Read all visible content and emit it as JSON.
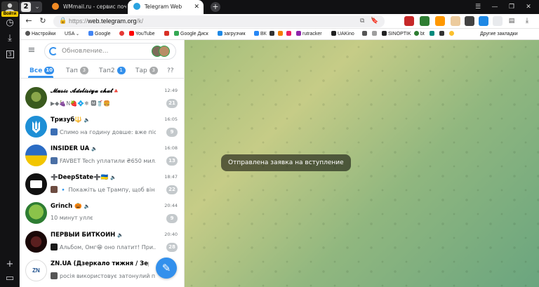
{
  "rail": {
    "user_badge": "Войти"
  },
  "tabs": {
    "counter": "2",
    "items": [
      {
        "title": "WMmail.ru - сервис почт",
        "active": false,
        "icon_color": "#f08a24"
      },
      {
        "title": "Telegram Web",
        "active": true,
        "icon_color": "#2aa3e0"
      }
    ]
  },
  "address": {
    "scheme": "https://",
    "domain": "web.telegram.org",
    "path": "/k/"
  },
  "bookmarks": [
    {
      "label": "Настройки",
      "color": "#555555"
    },
    {
      "label": "USA",
      "color": "#ffffff"
    },
    {
      "label": "Google",
      "color": "#4285f4"
    },
    {
      "label": "",
      "color": "#e53935"
    },
    {
      "label": "YouTube",
      "color": "#ff0000"
    },
    {
      "label": "",
      "color": "#d93025"
    },
    {
      "label": "Google Диск",
      "color": "#34a853"
    },
    {
      "label": "загрузчик",
      "color": "#1e88e5"
    },
    {
      "label": "ВК",
      "color": "#2787f5"
    },
    {
      "label": "",
      "color": "#333333"
    },
    {
      "label": "",
      "color": "#f57c00"
    },
    {
      "label": "",
      "color": "#e91e63"
    },
    {
      "label": "rutracker",
      "color": "#8e24aa"
    },
    {
      "label": "UAKino",
      "color": "#212121"
    },
    {
      "label": "",
      "color": "#555555"
    },
    {
      "label": "",
      "color": "#9e9e9e"
    },
    {
      "label": "SINOPTIK",
      "color": "#222222"
    },
    {
      "label": "bt",
      "color": "#2e7d32"
    },
    {
      "label": "",
      "color": "#00897b"
    },
    {
      "label": "",
      "color": "#333333"
    },
    {
      "label": "",
      "color": "#fbc02d"
    },
    {
      "label": "Другие закладки",
      "color": "#ffffff"
    }
  ],
  "telegram": {
    "search_status": "Обновление...",
    "folders": [
      {
        "label": "Все",
        "count": "10"
      },
      {
        "label": "Тап",
        "count": "3"
      },
      {
        "label": "Тап2",
        "count": "1"
      },
      {
        "label": "Тар",
        "count": "3"
      },
      {
        "label": "??",
        "count": ""
      }
    ],
    "chats": [
      {
        "title": "𝓜𝓾𝓼𝓲𝓬 𝓐𝓭𝓮𝓵𝓲𝓼𝓲𝔂𝓪 𝓬𝓱𝓪𝓽🔺",
        "time": "12:49",
        "message": "▶◆🍇N🍓💠❄ 🅼🥤🍔",
        "count": "21",
        "avatar_color": "#3a5a1e",
        "thumb_color": "#000000"
      },
      {
        "title": "Тризуб🔱",
        "time": "16:05",
        "message": "Спимо на годину довше: вже післ...",
        "count": "9",
        "avatar_color": "#1e8fd6",
        "thumb_color": "#3b6fb5"
      },
      {
        "title": "INSIDER UA",
        "time": "16:08",
        "message": "FAVBET Tech уплатили ₴650 мил...",
        "count": "13",
        "avatar_color": "#f2c500",
        "thumb_color": "#4a6fa5"
      },
      {
        "title": "➕DeepState➕🇺🇦",
        "time": "18:47",
        "message": "🔹 Покажіть це Трампу, щоб він ...",
        "count": "22",
        "avatar_color": "#111111",
        "thumb_color": "#6d4c41"
      },
      {
        "title": "Grinch 🎃",
        "time": "20:44",
        "message": "10 минут уллє",
        "count": "9",
        "avatar_color": "#4caf50",
        "thumb_color": ""
      },
      {
        "title": "ПЕРВЫЙ БИТКОИН",
        "time": "20:40",
        "message": "Альбом, Омг😁 оно платит! При...",
        "count": "28",
        "avatar_color": "#2b0f0f",
        "thumb_color": "#1a1a1a"
      },
      {
        "title": "ZN.UA (Дзеркало тижня / Зеркал...",
        "time": "",
        "message": "росія використовує затонулий п...",
        "count": "",
        "avatar_color": "#ffffff",
        "thumb_color": "#555555"
      }
    ],
    "toast": "Отправлена заявка на вступление"
  }
}
